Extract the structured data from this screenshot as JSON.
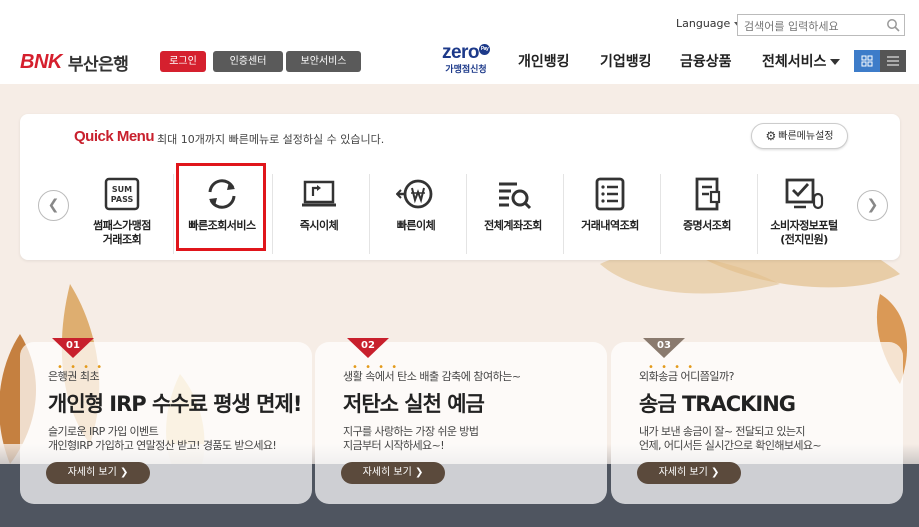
{
  "header": {
    "language_label": "Language",
    "search_placeholder": "검색어를 입력하세요",
    "logo_brand": "BNK",
    "logo_bank": "부산은행",
    "login_label": "로그인",
    "cert_label": "인증센터",
    "security_label": "보안서비스",
    "zero_pay_top": "zero",
    "zero_pay_badge": "Pay",
    "zero_pay_bottom": "가맹점신청",
    "nav": [
      "개인뱅킹",
      "기업뱅킹",
      "금융상품",
      "전체서비스"
    ]
  },
  "quick_menu": {
    "title": "Quick Menu",
    "description": "최대 10개까지 빠른메뉴로 설정하실 수 있습니다.",
    "settings_label": "빠른메뉴설정",
    "items": [
      {
        "label": "썸패스가맹점\n거래조회",
        "icon": "sumpass-icon"
      },
      {
        "label": "빠른조회서비스",
        "icon": "refresh-icon"
      },
      {
        "label": "즉시이체",
        "icon": "laptop-transfer-icon"
      },
      {
        "label": "빠른이체",
        "icon": "won-fast-icon"
      },
      {
        "label": "전체계좌조회",
        "icon": "list-search-icon"
      },
      {
        "label": "거래내역조회",
        "icon": "list-doc-icon"
      },
      {
        "label": "증명서조회",
        "icon": "certificate-icon"
      },
      {
        "label": "소비자정보포털\n(전지민원)",
        "icon": "monitor-check-icon"
      }
    ],
    "sumpass_text_1": "SUM",
    "sumpass_text_2": "PASS",
    "highlighted_item": "빠른조회서비스"
  },
  "cards": [
    {
      "num": "01",
      "tag": "은행권 최초",
      "title": "개인형 IRP 수수료 평생 면제!",
      "desc": [
        "슬기로운 IRP 가입 이벤트",
        "개인형IRP 가입하고 연말정산 받고! 경품도 받으세요!"
      ],
      "button": "자세히 보기",
      "badge_color": "#c8202d"
    },
    {
      "num": "02",
      "tag": "생활 속에서 탄소 배출 감축에 참여하는~",
      "title": "저탄소 실천 예금",
      "desc": [
        "지구를 사랑하는 가장 쉬운 방법",
        "지금부터 시작하세요~!"
      ],
      "button": "자세히 보기",
      "badge_color": "#c8202d"
    },
    {
      "num": "03",
      "tag": "외화송금 어디쯤일까?",
      "title": "송금 TRACKING",
      "desc": [
        "내가 보낸 송금이 잘~ 전달되고 있는지",
        "언제, 어디서든 실시간으로 확인해보세요~"
      ],
      "button": "자세히 보기",
      "badge_color": "#8a7a6e"
    }
  ],
  "colors": {
    "brand_red": "#d5202e",
    "quick_title": "#c8202d",
    "highlight": "#e0151b"
  }
}
